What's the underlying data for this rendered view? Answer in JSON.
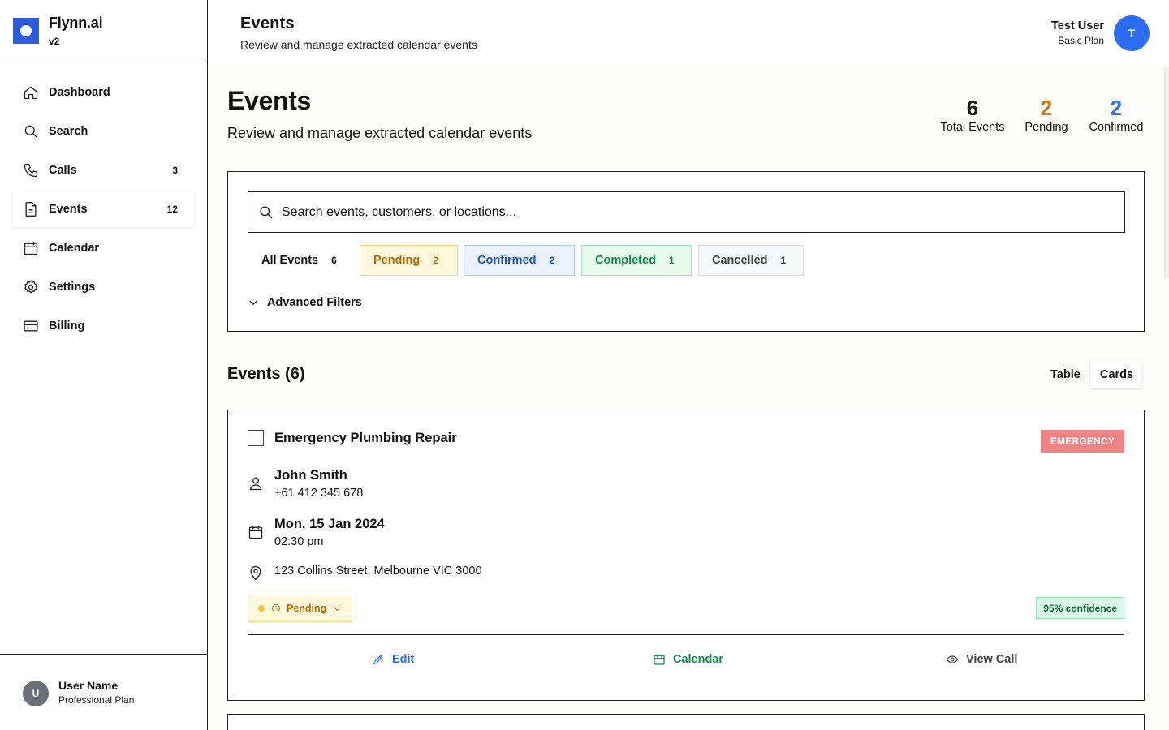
{
  "brand": {
    "name": "Flynn.ai",
    "version": "v2"
  },
  "sidebar": {
    "items": [
      {
        "label": "Dashboard",
        "icon": "home-icon",
        "badge": ""
      },
      {
        "label": "Search",
        "icon": "search-icon",
        "badge": ""
      },
      {
        "label": "Calls",
        "icon": "phone-icon",
        "badge": "3"
      },
      {
        "label": "Events",
        "icon": "document-icon",
        "badge": "12",
        "active": true
      },
      {
        "label": "Calendar",
        "icon": "calendar-icon",
        "badge": ""
      },
      {
        "label": "Settings",
        "icon": "gear-icon",
        "badge": ""
      },
      {
        "label": "Billing",
        "icon": "credit-card-icon",
        "badge": ""
      }
    ],
    "footer": {
      "avatar": "U",
      "name": "User Name",
      "plan": "Professional Plan"
    }
  },
  "header": {
    "title": "Events",
    "subtitle": "Review and manage extracted calendar events",
    "user": {
      "name": "Test User",
      "plan": "Basic Plan",
      "avatar": "T"
    }
  },
  "main": {
    "title": "Events",
    "subtitle": "Review and manage extracted calendar events",
    "stats": [
      {
        "value": "6",
        "label": "Total Events",
        "color": "#111111"
      },
      {
        "value": "2",
        "label": "Pending",
        "color": "#d9730d"
      },
      {
        "value": "2",
        "label": "Confirmed",
        "color": "#2c6cf2"
      }
    ],
    "search": {
      "placeholder": "Search events, customers, or locations...",
      "value": ""
    },
    "filters": [
      {
        "label": "All Events",
        "count": "6"
      },
      {
        "label": "Pending",
        "count": "2"
      },
      {
        "label": "Confirmed",
        "count": "2"
      },
      {
        "label": "Completed",
        "count": "1"
      },
      {
        "label": "Cancelled",
        "count": "1"
      }
    ],
    "advanced_filters": "Advanced Filters",
    "list_title": "Events (6)",
    "views": {
      "table": "Table",
      "cards": "Cards",
      "selected": "Cards"
    }
  },
  "event_card": {
    "title": "Emergency Plumbing Repair",
    "badge": "EMERGENCY",
    "customer_name": "John Smith",
    "customer_phone": "+61 412 345 678",
    "date": "Mon, 15 Jan 2024",
    "time": "02:30 pm",
    "address": "123 Collins Street, Melbourne VIC 3000",
    "status": "Pending",
    "confidence": "95% confidence",
    "actions": {
      "edit": "Edit",
      "calendar": "Calendar",
      "view_call": "View Call"
    }
  },
  "colors": {
    "brand": "#2d5bdf",
    "pending": "#b56a00",
    "confirmed": "#2c6cf2",
    "completed": "#0e8a47",
    "emergency": "#ee8484"
  }
}
